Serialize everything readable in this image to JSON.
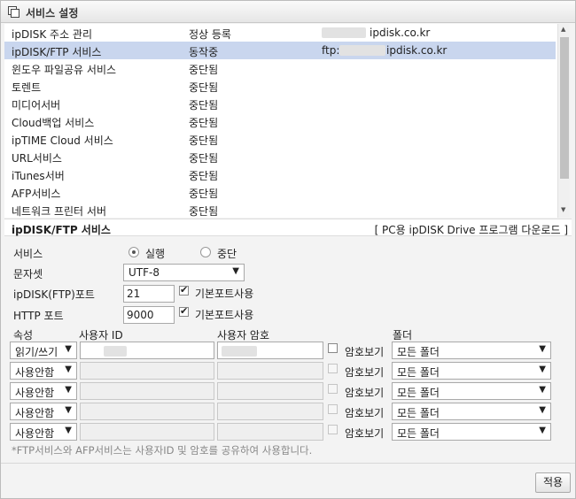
{
  "title": "서비스 설정",
  "services": [
    {
      "name": "ipDISK 주소 관리",
      "status": "정상 등록",
      "info_prefix": "",
      "info": "ipdisk.co.kr"
    },
    {
      "name": "ipDISK/FTP 서비스",
      "status": "동작중",
      "info_prefix": "ftp://",
      "info": "ipdisk.co.kr"
    },
    {
      "name": "윈도우 파일공유 서비스",
      "status": "중단됨"
    },
    {
      "name": "토렌트",
      "status": "중단됨"
    },
    {
      "name": "미디어서버",
      "status": "중단됨"
    },
    {
      "name": "Cloud백업 서비스",
      "status": "중단됨"
    },
    {
      "name": "ipTIME Cloud 서비스",
      "status": "중단됨"
    },
    {
      "name": "URL서비스",
      "status": "중단됨"
    },
    {
      "name": "iTunes서버",
      "status": "중단됨"
    },
    {
      "name": "AFP서비스",
      "status": "중단됨"
    },
    {
      "name": "네트워크 프린터 서버",
      "status": "중단됨"
    }
  ],
  "section": {
    "title": "ipDISK/FTP 서비스",
    "download_link": "[ PC용 ipDISK Drive 프로그램 다운로드 ]"
  },
  "form": {
    "service_label": "서비스",
    "run_label": "실행",
    "stop_label": "중단",
    "charset_label": "문자셋",
    "charset_value": "UTF-8",
    "ftp_port_label": "ipDISK(FTP)포트",
    "ftp_port_value": "21",
    "http_port_label": "HTTP 포트",
    "http_port_value": "9000",
    "default_port_label": "기본포트사용"
  },
  "users": {
    "headers": {
      "attr": "속성",
      "id": "사용자 ID",
      "pw": "사용자 암호",
      "folder": "폴더"
    },
    "show_pw_label": "암호보기",
    "rows": [
      {
        "attr": "읽기/쓰기",
        "folder": "모든 폴더"
      },
      {
        "attr": "사용안함",
        "folder": "모든 폴더"
      },
      {
        "attr": "사용안함",
        "folder": "모든 폴더"
      },
      {
        "attr": "사용안함",
        "folder": "모든 폴더"
      },
      {
        "attr": "사용안함",
        "folder": "모든 폴더"
      }
    ]
  },
  "note": "*FTP서비스와 AFP서비스는 사용자ID 및 암호를 공유하여 사용합니다.",
  "apply_label": "적용"
}
